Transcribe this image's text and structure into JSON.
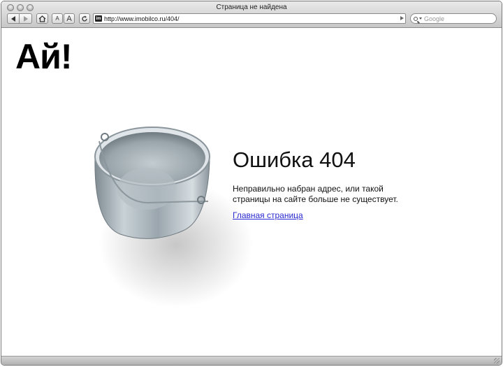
{
  "window": {
    "title": "Страница не найдена"
  },
  "toolbar": {
    "font_small_label": "A",
    "font_large_label": "A",
    "address_value": "http://www.imobilco.ru/404/",
    "search_placeholder": "Google",
    "favicon_label": "im"
  },
  "page": {
    "heading": "Ай!",
    "error_title": "Ошибка 404",
    "error_text": "Неправильно набран адрес, или такой страницы на сайте больше не существует.",
    "home_link": "Главная страница",
    "link_color": "#2a2ad0"
  }
}
